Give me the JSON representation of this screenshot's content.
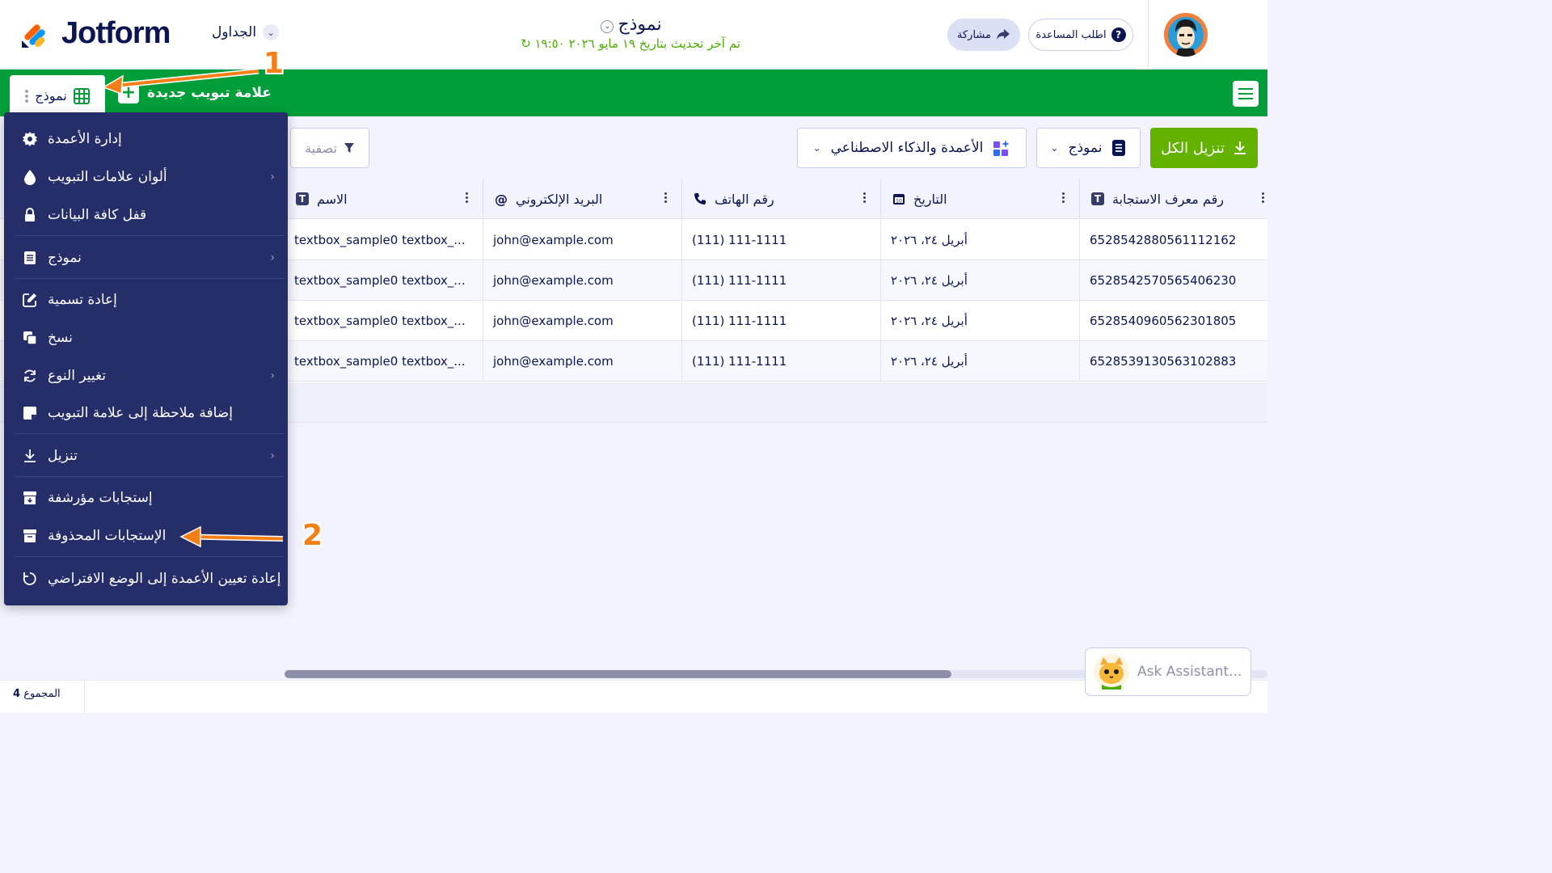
{
  "header": {
    "logo_text": "Jotform",
    "tables_dropdown": "الجداول",
    "form_title": "نموذج",
    "last_updated": "تم آخر تحديث بتاريخ ١٩ مايو ٢٠٢٦ ١٩:٥٠",
    "share_label": "مشاركة",
    "help_label": "اطلب المساعدة"
  },
  "tabbar": {
    "active_tab": "نموذج",
    "new_tab": "علامة تبويب جديدة"
  },
  "toolbar": {
    "filter": "تصفية",
    "columns_ai": "الأعمدة والذكاء الاصطناعي",
    "form_dropdown": "نموذج",
    "download_all": "تنزيل الكل"
  },
  "table": {
    "columns": [
      "الاسم",
      "البريد الإلكتروني",
      "رقم الهاتف",
      "التاريخ",
      "رقم معرف الاستجابة"
    ],
    "rows": [
      [
        "textbox_sample0 textbox_...",
        "john@example.com",
        "(111) 111-1111",
        "أبريل ٢٤، ٢٠٢٦",
        "6528542880561112162"
      ],
      [
        "textbox_sample0 textbox_...",
        "john@example.com",
        "(111) 111-1111",
        "أبريل ٢٤، ٢٠٢٦",
        "6528542570565406230"
      ],
      [
        "textbox_sample0 textbox_...",
        "john@example.com",
        "(111) 111-1111",
        "أبريل ٢٤، ٢٠٢٦",
        "6528540960562301805"
      ],
      [
        "textbox_sample0 textbox_...",
        "john@example.com",
        "(111) 111-1111",
        "أبريل ٢٤، ٢٠٢٦",
        "6528539130563102883"
      ]
    ]
  },
  "menu": {
    "items": [
      "إدارة الأعمدة",
      "ألوان علامات التبويب",
      "قفل كافة البيانات",
      "نموذج",
      "إعادة تسمية",
      "نسخ",
      "تغيير النوع",
      "إضافة ملاحظة إلى علامة التبويب",
      "تنزيل",
      "إستجابات مؤرشفة",
      "الإستجابات المحذوفة",
      "إعادة تعيين الأعمدة إلى الوضع الافتراضي"
    ]
  },
  "footer": {
    "total_label": "المجموع",
    "total_count": "4"
  },
  "assistant": {
    "label": "Ask Assistant..."
  },
  "annotations": {
    "step1": "1",
    "step2": "2"
  },
  "colors": {
    "green_bar": "#009e3a",
    "download_btn": "#64b200",
    "menu_bg": "#262e6a",
    "annotation_orange": "#f57f17"
  }
}
